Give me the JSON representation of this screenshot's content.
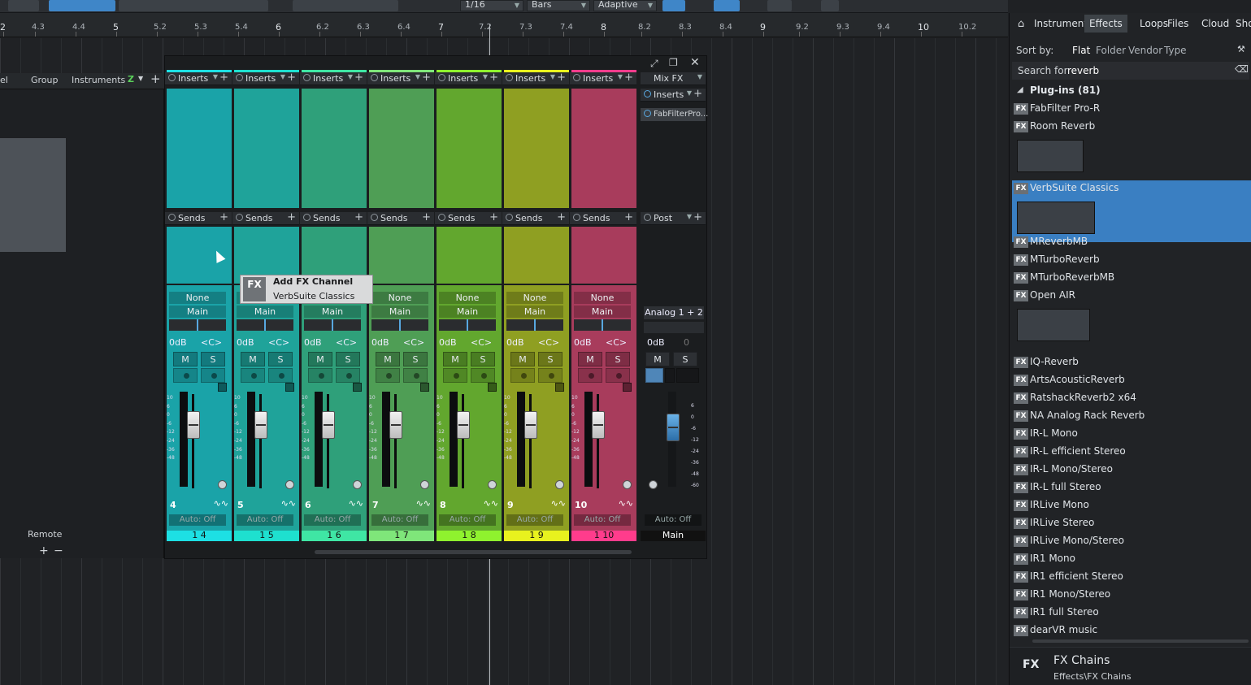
{
  "toolbar": {
    "quantize": "1/16",
    "timebase": "Bars",
    "snap": "Adaptive"
  },
  "ruler": {
    "labels": [
      "2",
      "4.3",
      "4.4",
      "5",
      "5.2",
      "5.3",
      "5.4",
      "6",
      "6.2",
      "6.3",
      "6.4",
      "7",
      "7.2",
      "7.3",
      "7.4",
      "8",
      "8.2",
      "8.3",
      "8.4",
      "9",
      "9.2",
      "9.3",
      "9.4",
      "10",
      "10.2"
    ],
    "major": [
      "2",
      "5",
      "6",
      "7",
      "8",
      "9",
      "10"
    ]
  },
  "left": {
    "col_el": "el",
    "group": "Group",
    "instruments": "Instruments",
    "remote": "Remote"
  },
  "console": {
    "channels": [
      {
        "num": "4",
        "name": "1 4",
        "color": "#1aa3a8",
        "bar": "#1de0e4",
        "insert_label": "Inserts",
        "send_label": "Sends",
        "input": "None",
        "output": "Main",
        "vol": "0dB",
        "pan": "<C>",
        "mute": "M",
        "solo": "S",
        "auto": "Auto: Off"
      },
      {
        "num": "5",
        "name": "1 5",
        "color": "#1fa39a",
        "bar": "#1ee0cf",
        "insert_label": "Inserts",
        "send_label": "Sends",
        "input": "None",
        "output": "Main",
        "vol": "0dB",
        "pan": "<C>",
        "mute": "M",
        "solo": "S",
        "auto": "Auto: Off"
      },
      {
        "num": "6",
        "name": "1 6",
        "color": "#2fa07a",
        "bar": "#3fe6a4",
        "insert_label": "Inserts",
        "send_label": "Sends",
        "input": "None",
        "output": "Main",
        "vol": "0dB",
        "pan": "<C>",
        "mute": "M",
        "solo": "S",
        "auto": "Auto: Off"
      },
      {
        "num": "7",
        "name": "1 7",
        "color": "#4f9e55",
        "bar": "#7fe67a",
        "insert_label": "Inserts",
        "send_label": "Sends",
        "input": "None",
        "output": "Main",
        "vol": "0dB",
        "pan": "<C>",
        "mute": "M",
        "solo": "S",
        "auto": "Auto: Off"
      },
      {
        "num": "8",
        "name": "1 8",
        "color": "#62a72e",
        "bar": "#8ff22e",
        "insert_label": "Inserts",
        "send_label": "Sends",
        "input": "None",
        "output": "Main",
        "vol": "0dB",
        "pan": "<C>",
        "mute": "M",
        "solo": "S",
        "auto": "Auto: Off"
      },
      {
        "num": "9",
        "name": "1 9",
        "color": "#8f9f22",
        "bar": "#e8f21e",
        "insert_label": "Inserts",
        "send_label": "Sends",
        "input": "None",
        "output": "Main",
        "vol": "0dB",
        "pan": "<C>",
        "mute": "M",
        "solo": "S",
        "auto": "Auto: Off"
      },
      {
        "num": "10",
        "name": "1 10",
        "color": "#a83c5c",
        "bar": "#ff3c8c",
        "insert_label": "Inserts",
        "send_label": "Sends",
        "input": "None",
        "output": "Main",
        "vol": "0dB",
        "pan": "<C>",
        "mute": "M",
        "solo": "S",
        "auto": "Auto: Off"
      }
    ],
    "main": {
      "mixfx": "Mix FX",
      "inserts": "Inserts",
      "plugin": "FabFilterPro...",
      "post": "Post",
      "input": "Analog 1 + 2",
      "vol": "0dB",
      "pan": "0",
      "mute": "M",
      "solo": "S",
      "auto": "Auto: Off",
      "name": "Main"
    },
    "scale": [
      "10",
      "6",
      "0",
      "-6",
      "-12",
      "-24",
      "-36",
      "-48"
    ],
    "main_scale": [
      "6",
      "0",
      "-6",
      "-12",
      "-24",
      "-36",
      "-48",
      "-60"
    ]
  },
  "popup": {
    "badge": "FX",
    "title": "Add FX Channel",
    "item": "VerbSuite Classics"
  },
  "browser": {
    "tabs": [
      "Instruments",
      "Effects",
      "Loops",
      "Files",
      "Cloud",
      "Shop"
    ],
    "selected_tab": "Effects",
    "sort_label": "Sort by:",
    "sort_options": [
      "Flat",
      "Folder",
      "Vendor",
      "Type"
    ],
    "search_label": "Search for",
    "search_value": "reverb",
    "group": "Plug-ins (81)",
    "plugins": [
      "FabFilter Pro-R",
      "Room Reverb",
      "VerbSuite Classics",
      "MReverbMB",
      "MTurboReverb",
      "MTurboReverbMB",
      "Open AIR",
      "IQ-Reverb",
      "ArtsAcousticReverb",
      "RatshackReverb2 x64",
      "NA Analog Rack Reverb",
      "IR-L Mono",
      "IR-L efficient Stereo",
      "IR-L Mono/Stereo",
      "IR-L full Stereo",
      "IRLive Mono",
      "IRLive Stereo",
      "IRLive Mono/Stereo",
      "IR1 Mono",
      "IR1 efficient Stereo",
      "IR1 Mono/Stereo",
      "IR1 full Stereo",
      "dearVR music"
    ],
    "selected_plugin": "VerbSuite Classics",
    "chains_title": "FX Chains",
    "chains_path": "Effects\\FX Chains"
  }
}
